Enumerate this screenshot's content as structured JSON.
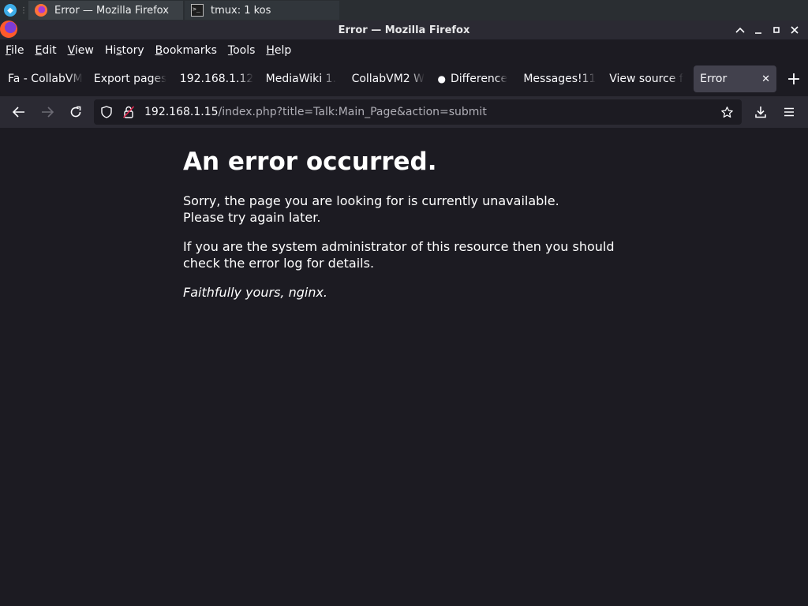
{
  "taskbar": {
    "tasks": [
      {
        "label": "Error — Mozilla Firefox",
        "icon": "firefox-icon"
      },
      {
        "label": "tmux: 1 kos",
        "icon": "terminal-icon"
      }
    ]
  },
  "window": {
    "title": "Error — Mozilla Firefox"
  },
  "menu": {
    "items": [
      {
        "label": "File",
        "accel": "F",
        "rest": "ile"
      },
      {
        "label": "Edit",
        "accel": "E",
        "rest": "dit"
      },
      {
        "label": "View",
        "accel": "V",
        "rest": "iew"
      },
      {
        "label": "History",
        "pre": "Hi",
        "accel": "s",
        "rest": "tory"
      },
      {
        "label": "Bookmarks",
        "accel": "B",
        "rest": "ookmarks"
      },
      {
        "label": "Tools",
        "accel": "T",
        "rest": "ools"
      },
      {
        "label": "Help",
        "accel": "H",
        "rest": "elp"
      }
    ]
  },
  "tabs": [
    {
      "label": "Fa - CollabVM"
    },
    {
      "label": "Export pages"
    },
    {
      "label": "192.168.1.12"
    },
    {
      "label": "MediaWiki 1."
    },
    {
      "label": "CollabVM2 W"
    },
    {
      "label": "Difference",
      "icon": "apple-icon"
    },
    {
      "label": "Messages!11"
    },
    {
      "label": "View source f"
    },
    {
      "label": "Error",
      "selected": true
    }
  ],
  "navbar": {
    "url_host": "192.168.1.15",
    "url_path": "/index.php?title=Talk:Main_Page&action=submit"
  },
  "page": {
    "heading": "An error occurred.",
    "para1_line1": "Sorry, the page you are looking for is currently unavailable.",
    "para1_line2": "Please try again later.",
    "para2_line1": "If you are the system administrator of this resource then you should",
    "para2_line2": "check the error log for details.",
    "signature": "Faithfully yours, nginx."
  },
  "colors": {
    "page_bg": "#1c1b22",
    "chrome_bg": "#2b2a33",
    "selected_tab": "#42414d",
    "taskbar_bg": "#2a2e32"
  }
}
